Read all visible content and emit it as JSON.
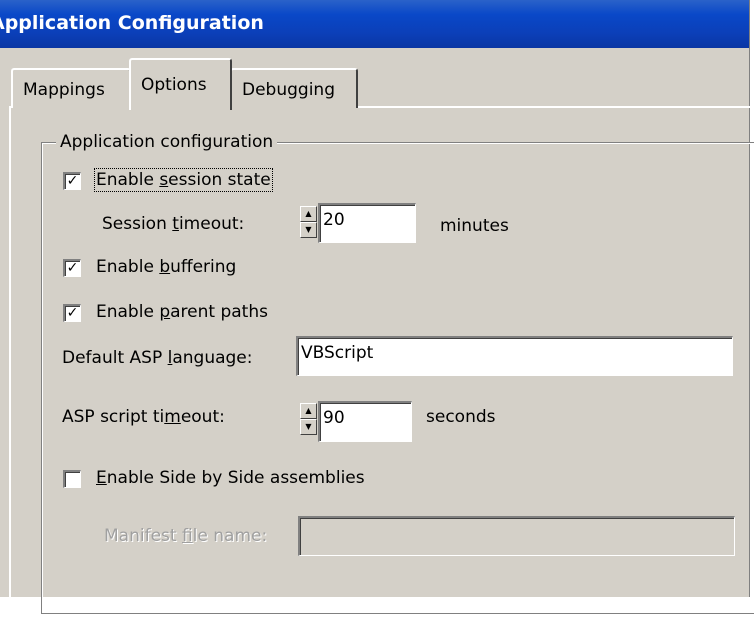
{
  "window": {
    "title": "Application Configuration"
  },
  "tabs": [
    {
      "label": "Mappings"
    },
    {
      "label": "Options",
      "selected": true
    },
    {
      "label": "Debugging"
    }
  ],
  "group": {
    "label": "Application configuration",
    "session_state": {
      "pre": "Enable ",
      "key": "s",
      "post": "ession state",
      "checked": true,
      "mark": "✓"
    },
    "session_timeout": {
      "label_pre": "Session ",
      "label_key": "t",
      "label_post": "imeout:",
      "value": "20",
      "unit": "minutes"
    },
    "buffering": {
      "pre": "Enable ",
      "key": "b",
      "post": "uffering",
      "checked": true,
      "mark": "✓"
    },
    "parent_paths": {
      "pre": "Enable ",
      "key": "p",
      "post": "arent paths",
      "checked": true,
      "mark": "✓"
    },
    "asp_language": {
      "label_pre": "Default ASP ",
      "label_key": "l",
      "label_post": "anguage:",
      "value": "VBScript"
    },
    "script_timeout": {
      "label_pre": "ASP script ti",
      "label_key": "m",
      "label_post": "eout:",
      "value": "90",
      "unit": "seconds"
    },
    "side_by_side": {
      "key": "E",
      "post": "nable Side by Side assemblies",
      "checked": false,
      "mark": ""
    },
    "manifest": {
      "label_pre": "Manifest ",
      "label_key": "f",
      "label_post": "ile name:",
      "value": ""
    }
  },
  "icons": {
    "spin_up": "▲",
    "spin_down": "▼"
  },
  "colors": {
    "titlebar": "#0a48c8",
    "face": "#d4d0c8"
  }
}
